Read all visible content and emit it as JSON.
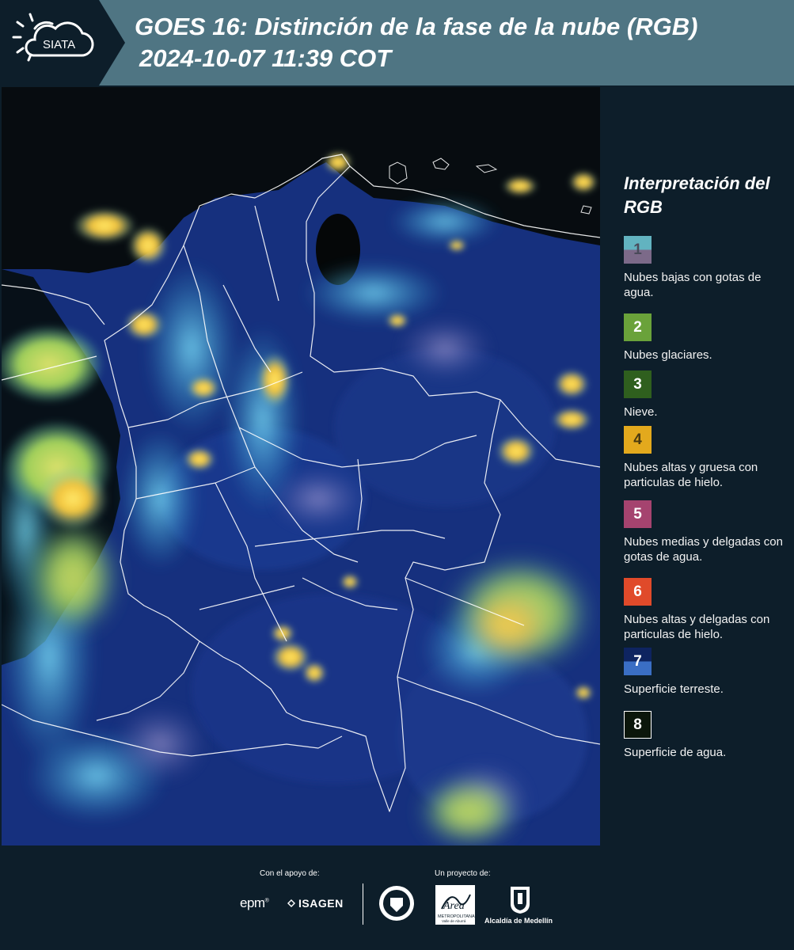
{
  "header": {
    "title_line1": "GOES 16: Distinción de la fase de la nube (RGB)",
    "title_line2": "2024-10-07 11:39 COT",
    "logo_text": "SIATA"
  },
  "legend": {
    "title": "Interpretación del RGB",
    "items": [
      {
        "num": "1",
        "label": "Nubes bajas con gotas de agua.",
        "color_top": "#62b3c0",
        "color_bottom": "#7c6a89",
        "text_color": "#4a4a5a"
      },
      {
        "num": "2",
        "label": "Nubes glaciares.",
        "color_top": "#6aa23a",
        "color_bottom": "#6aa23a",
        "text_color": "#ffffff"
      },
      {
        "num": "3",
        "label": "Nieve.",
        "color_top": "#2f5f1e",
        "color_bottom": "#2f5f1e",
        "text_color": "#ffffff"
      },
      {
        "num": "4",
        "label": "Nubes altas y gruesa con particulas de hielo.",
        "color_top": "#e3a91d",
        "color_bottom": "#e3a91d",
        "text_color": "#4a3a10"
      },
      {
        "num": "5",
        "label": "Nubes medias y delgadas con gotas de agua.",
        "color_top": "#a5436f",
        "color_bottom": "#a5436f",
        "text_color": "#ffffff"
      },
      {
        "num": "6",
        "label": "Nubes altas y delgadas con particulas de hielo.",
        "color_top": "#e04a2a",
        "color_bottom": "#e04a2a",
        "text_color": "#ffffff"
      },
      {
        "num": "7",
        "label": "Superficie terreste.",
        "color_top": "#0e2460",
        "color_bottom": "#3a6ec4",
        "text_color": "#ffffff"
      },
      {
        "num": "8",
        "label": "Superficie de agua.",
        "color_top": "#0b160b",
        "color_bottom": "#0b160b",
        "text_color": "#ffffff"
      }
    ]
  },
  "footer": {
    "support_label": "Con el apoyo de:",
    "project_label": "Un proyecto de:",
    "epm": "epm",
    "isagen": "ISAGEN",
    "area_metro": "Área",
    "area_metro_sub": "METROPOLITANA",
    "area_metro_sub2": "Valle de Aburrá",
    "alcaldia": "Alcaldía de Medellín"
  },
  "colors": {
    "header_bg": "#4f7583",
    "panel_bg": "#0d1e2a",
    "land": "#17348a",
    "ocean": "#0a0f14"
  }
}
